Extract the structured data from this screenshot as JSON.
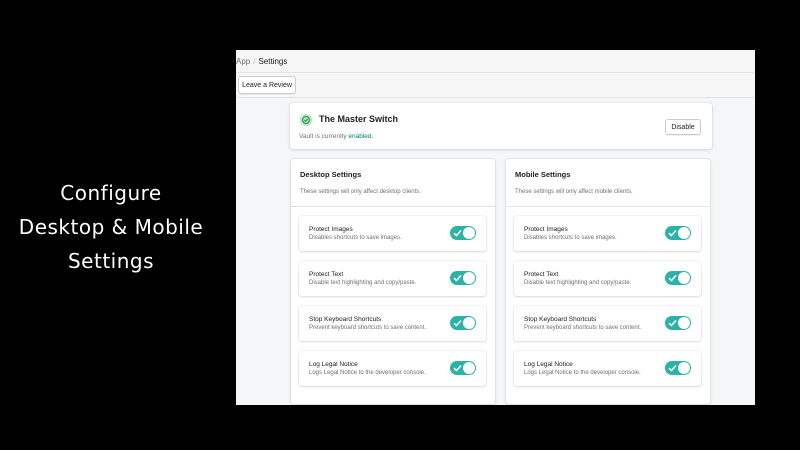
{
  "caption": {
    "line1": "Configure",
    "line2": "Desktop & Mobile",
    "line3": "Settings"
  },
  "breadcrumb": {
    "root": "App",
    "separator": "/",
    "current": "Settings"
  },
  "toolbar": {
    "review_label": "Leave a Review"
  },
  "master": {
    "title": "The Master Switch",
    "status_prefix": "Vault is currently ",
    "status_value": "enabled.",
    "disable_label": "Disable"
  },
  "desktop": {
    "title": "Desktop Settings",
    "description": "These settings will only affect desktop clients.",
    "items": [
      {
        "label": "Protect Images",
        "description": "Disables shortcuts to save images.",
        "enabled": true
      },
      {
        "label": "Protect Text",
        "description": "Disable text highlighting and copy/paste.",
        "enabled": true
      },
      {
        "label": "Stop Keyboard Shortcuts",
        "description": "Prevent keyboard shortcuts to save content.",
        "enabled": true
      },
      {
        "label": "Log Legal Notice",
        "description": "Logs Legal Notice to the developer console.",
        "enabled": true
      }
    ]
  },
  "mobile": {
    "title": "Mobile Settings",
    "description": "These settings will only affect mobile clients.",
    "items": [
      {
        "label": "Protect Images",
        "description": "Disables shortcuts to save images.",
        "enabled": true
      },
      {
        "label": "Protect Text",
        "description": "Disable text highlighting and copy/paste.",
        "enabled": true
      },
      {
        "label": "Stop Keyboard Shortcuts",
        "description": "Prevent keyboard shortcuts to save content.",
        "enabled": true
      },
      {
        "label": "Log Legal Notice",
        "description": "Logs Legal Notice to the developer console.",
        "enabled": true
      }
    ]
  },
  "colors": {
    "toggle_on": "#2bb3a6",
    "success": "#008060",
    "check_bg": "#bbe5b3"
  },
  "icons": {
    "master": "check-circle-icon",
    "toggle": "checkmark-icon"
  }
}
